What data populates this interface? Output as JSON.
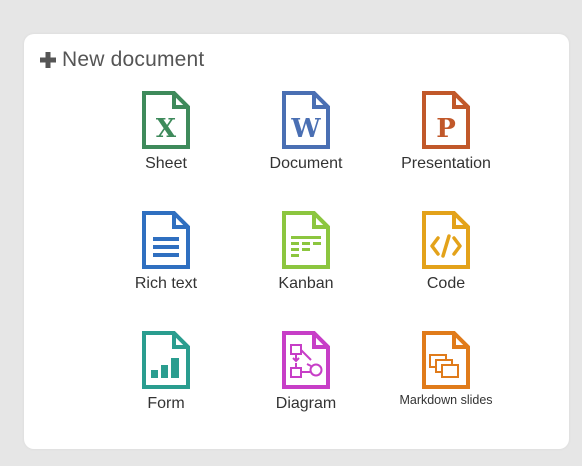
{
  "header": {
    "title": "New document"
  },
  "colors": {
    "sheet": "#3e8a5b",
    "document": "#4a6fb3",
    "presentation": "#c1582a",
    "richtext": "#2f6fc0",
    "kanban": "#8cc63f",
    "code": "#e3a21a",
    "form": "#2a9d8f",
    "diagram": "#c73ec7",
    "markdown": "#e07b1a"
  },
  "items": [
    {
      "label": "Sheet",
      "icon": "sheet-icon",
      "glyph": "X"
    },
    {
      "label": "Document",
      "icon": "document-icon",
      "glyph": "W"
    },
    {
      "label": "Presentation",
      "icon": "presentation-icon",
      "glyph": "P"
    },
    {
      "label": "Rich text",
      "icon": "rich-text-icon"
    },
    {
      "label": "Kanban",
      "icon": "kanban-icon"
    },
    {
      "label": "Code",
      "icon": "code-icon"
    },
    {
      "label": "Form",
      "icon": "form-icon"
    },
    {
      "label": "Diagram",
      "icon": "diagram-icon"
    },
    {
      "label": "Markdown slides",
      "icon": "markdown-slides-icon"
    }
  ]
}
